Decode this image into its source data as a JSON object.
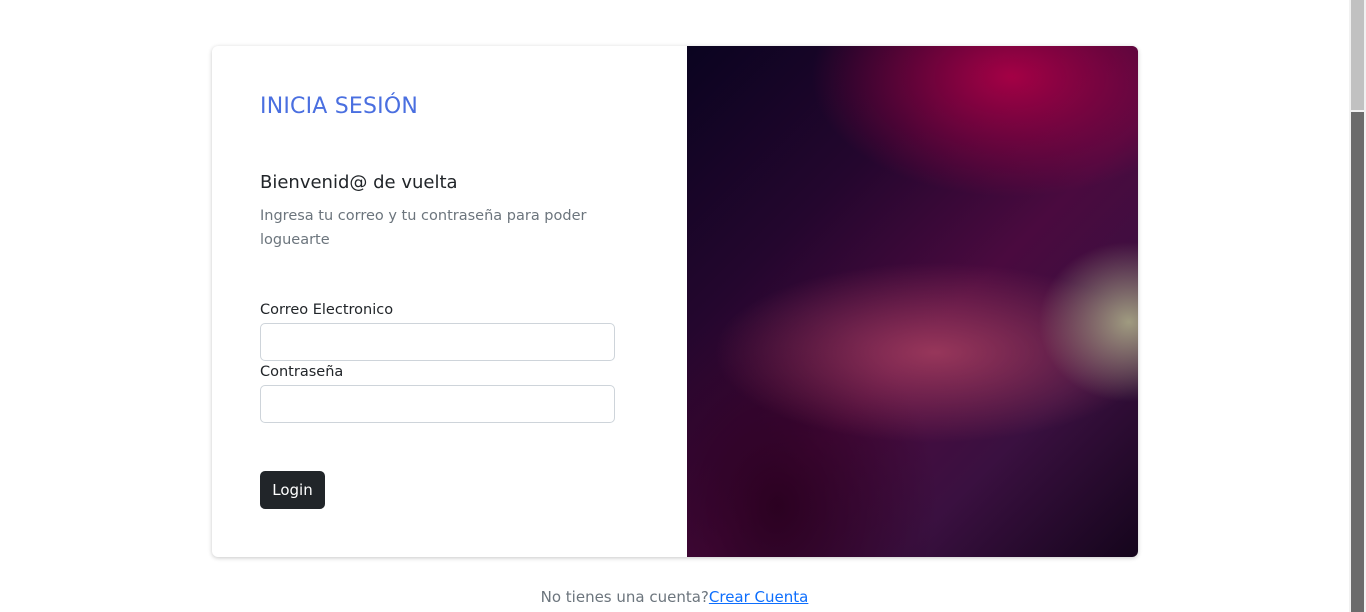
{
  "form": {
    "title": "INICIA SESIÓN",
    "subtitle": "Bienvenid@ de vuelta",
    "description": "Ingresa tu correo y tu contraseña para poder loguearte",
    "email_label": "Correo Electronico",
    "email_value": "",
    "password_label": "Contraseña",
    "password_value": "",
    "login_label": "Login"
  },
  "footer": {
    "prompt": "No tienes una cuenta?",
    "link_label": "Crear Cuenta"
  },
  "colors": {
    "title": "#4a6fe0",
    "button": "#212529",
    "link": "#0d6efd"
  }
}
